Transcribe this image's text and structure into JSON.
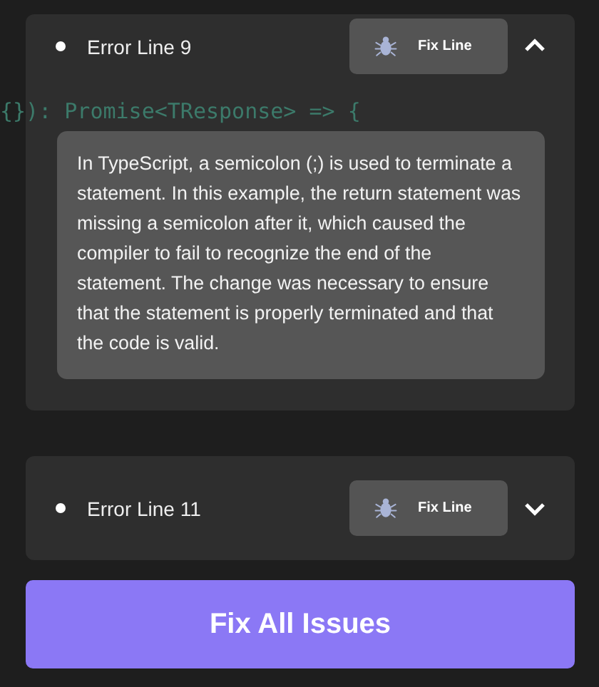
{
  "code_line": "{}): Promise<TResponse> => {",
  "errors": [
    {
      "label": "Error Line 9",
      "fix_button": "Fix Line",
      "expanded": true,
      "message": "In TypeScript, a semicolon (;) is used to terminate a statement. In this example, the return statement was missing a semicolon after it, which caused the compiler to fail to recognize the end of the statement. The change was necessary to ensure that the statement is properly terminated and that the code is valid."
    },
    {
      "label": "Error Line 11",
      "fix_button": "Fix Line",
      "expanded": false
    }
  ],
  "fix_all_button": "Fix All Issues"
}
